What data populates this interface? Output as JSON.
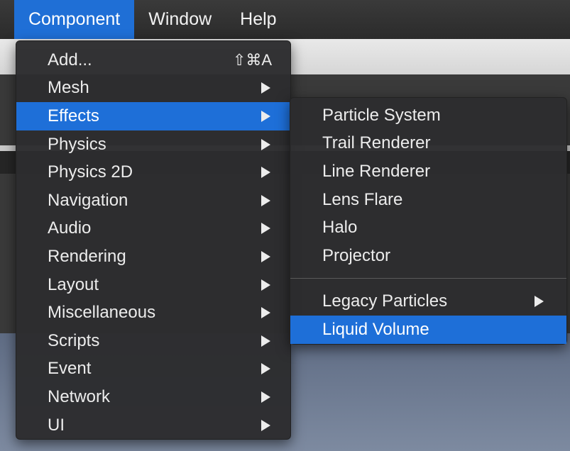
{
  "menubar": {
    "items": [
      "Component",
      "Window",
      "Help"
    ]
  },
  "component_menu": {
    "items": [
      {
        "label": "Add...",
        "shortcut": "⇧⌘A"
      },
      {
        "label": "Mesh",
        "submenu": true
      },
      {
        "label": "Effects",
        "submenu": true,
        "highlighted": true
      },
      {
        "label": "Physics",
        "submenu": true
      },
      {
        "label": "Physics 2D",
        "submenu": true
      },
      {
        "label": "Navigation",
        "submenu": true
      },
      {
        "label": "Audio",
        "submenu": true
      },
      {
        "label": "Rendering",
        "submenu": true
      },
      {
        "label": "Layout",
        "submenu": true
      },
      {
        "label": "Miscellaneous",
        "submenu": true
      },
      {
        "label": "Scripts",
        "submenu": true
      },
      {
        "label": "Event",
        "submenu": true
      },
      {
        "label": "Network",
        "submenu": true
      },
      {
        "label": "UI",
        "submenu": true
      }
    ]
  },
  "effects_submenu": {
    "items": [
      {
        "label": "Particle System"
      },
      {
        "label": "Trail Renderer"
      },
      {
        "label": "Line Renderer"
      },
      {
        "label": "Lens Flare"
      },
      {
        "label": "Halo"
      },
      {
        "label": "Projector"
      }
    ],
    "items_after_separator": [
      {
        "label": "Legacy Particles",
        "submenu": true
      },
      {
        "label": "Liquid Volume",
        "highlighted": true
      }
    ]
  },
  "colors": {
    "highlight": "#1e6fd8",
    "menu_background": "#2c2c2e",
    "menubar_background": "#333333",
    "menu_text": "#ececec"
  },
  "icons": {
    "submenu_indicator": "submenu-arrow-icon"
  }
}
